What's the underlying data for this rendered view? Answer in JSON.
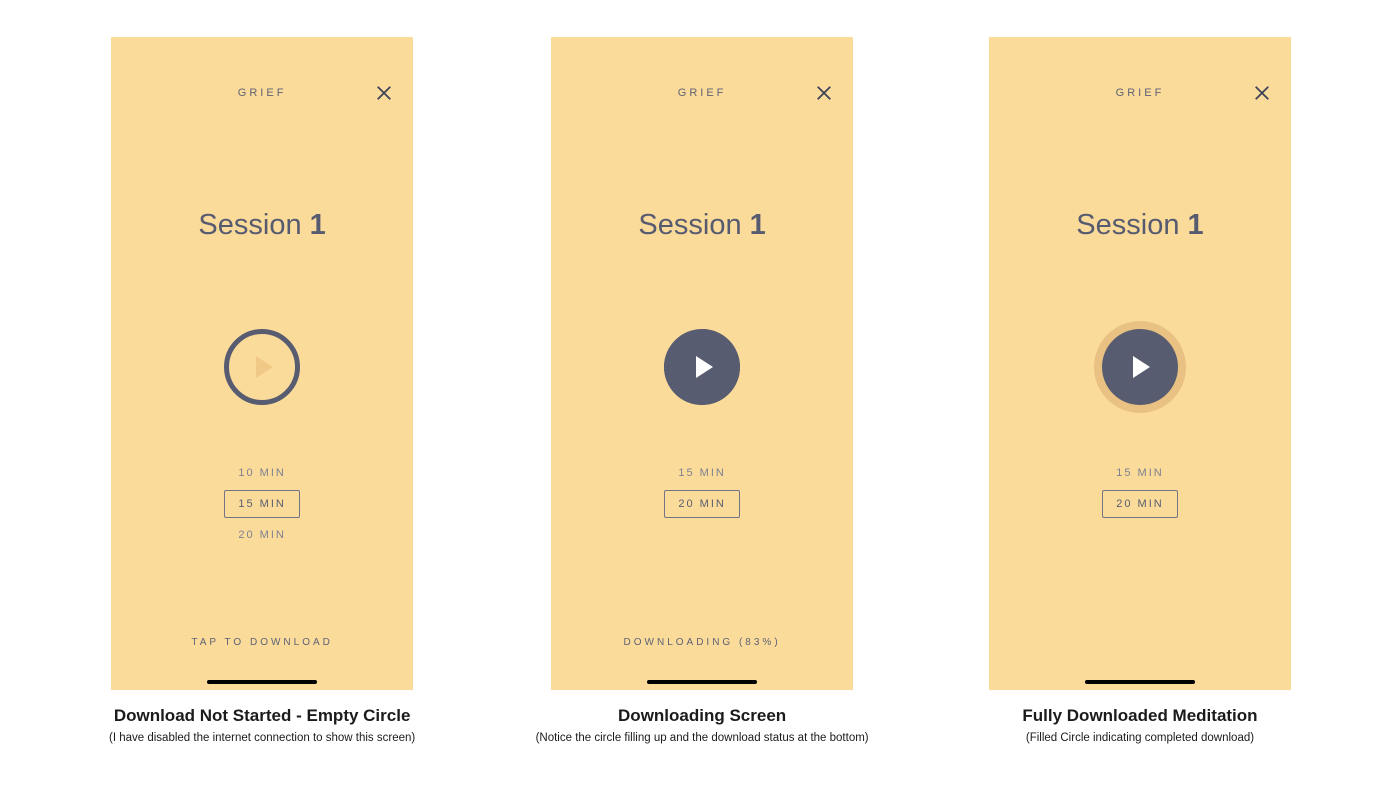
{
  "screens": [
    {
      "category": "GRIEF",
      "session_prefix": "Session ",
      "session_number": "1",
      "durations": [
        "10 MIN",
        "15 MIN",
        "20 MIN"
      ],
      "selected_index": 1,
      "status": "TAP TO DOWNLOAD",
      "caption_title": "Download Not Started - Empty Circle",
      "caption_sub": "(I have disabled the internet connection to show this screen)"
    },
    {
      "category": "GRIEF",
      "session_prefix": "Session ",
      "session_number": "1",
      "durations": [
        "15 MIN",
        "20 MIN"
      ],
      "selected_index": 1,
      "status": "DOWNLOADING (83%)",
      "caption_title": "Downloading Screen",
      "caption_sub": "(Notice the circle filling up and the download status at the bottom)"
    },
    {
      "category": "GRIEF",
      "session_prefix": "Session ",
      "session_number": "1",
      "durations": [
        "15 MIN",
        "20 MIN"
      ],
      "selected_index": 1,
      "status": "",
      "caption_title": "Fully Downloaded Meditation",
      "caption_sub": "(Filled Circle indicating completed download)"
    }
  ]
}
